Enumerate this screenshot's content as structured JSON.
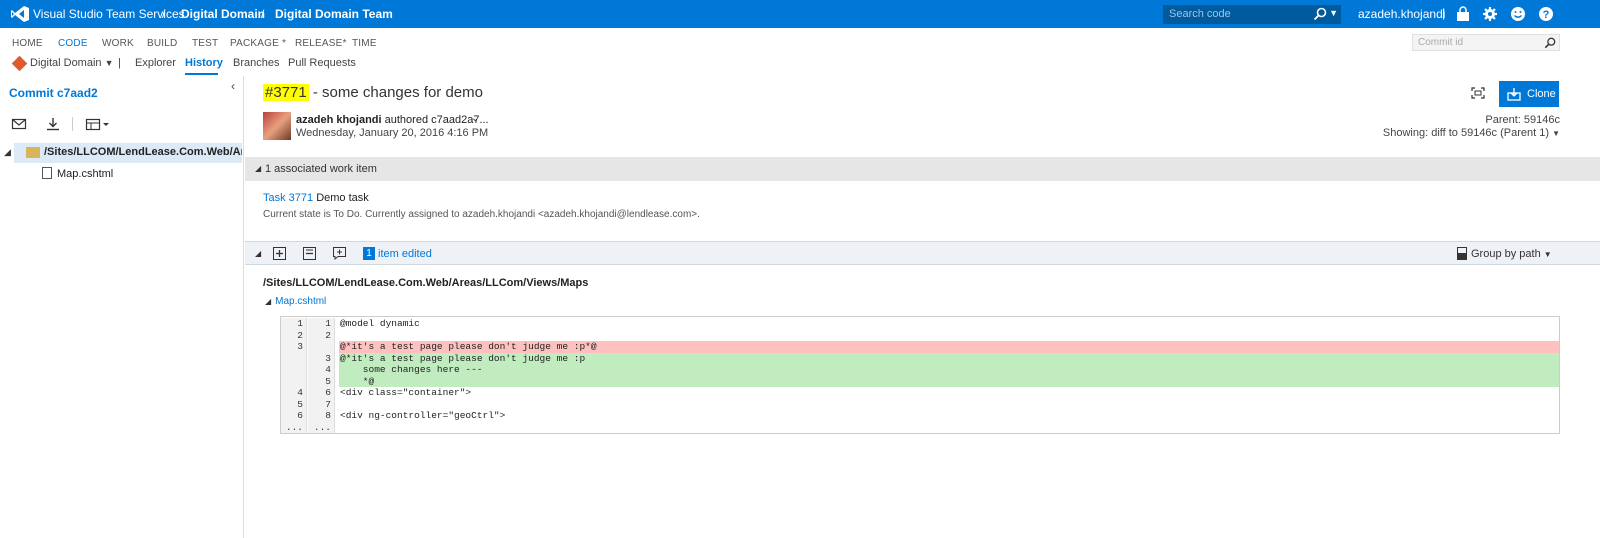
{
  "topbar": {
    "product": "Visual Studio Team Services",
    "sep1": "/",
    "project": "Digital Domain",
    "sep2": "/",
    "team": "Digital Domain Team",
    "search_placeholder": "Search code",
    "user": "azadeh.khojandi",
    "user_sep": "|"
  },
  "hubs": [
    "HOME",
    "CODE",
    "WORK",
    "BUILD",
    "TEST",
    "PACKAGE *",
    "RELEASE*",
    "TIME"
  ],
  "commit_search_placeholder": "Commit id",
  "subnav": {
    "repo": "Digital Domain",
    "sep": "|",
    "items": [
      "Explorer",
      "History",
      "Branches",
      "Pull Requests"
    ]
  },
  "left": {
    "title": "Commit c7aad2",
    "folder_path": "/Sites/LLCOM/LendLease.Com.Web/Areas/",
    "file": "Map.cshtml"
  },
  "commit": {
    "id_highlight": "#3771",
    "title_rest": " - some changes for demo",
    "author": "azadeh khojandi",
    "authored": " authored c7aad2a7...",
    "date": "Wednesday, January 20, 2016 4:16 PM",
    "parent": "Parent: 59146c",
    "showing": "Showing: diff to 59146c (Parent 1)",
    "clone_label": "Clone"
  },
  "workitems": {
    "header": "1 associated work item",
    "link": "Task 3771",
    "name": " Demo task",
    "state": "Current state is To Do. Currently assigned to azadeh.khojandi <azadeh.khojandi@lendlease.com>."
  },
  "changes": {
    "count": "1",
    "label": "item edited",
    "group_by": "Group by path",
    "file_path": "/Sites/LLCOM/LendLease.Com.Web/Areas/LLCom/Views/Maps",
    "file_name": "Map.cshtml"
  },
  "diff": [
    {
      "l": "1",
      "r": "1",
      "t": "",
      "code": "@model dynamic"
    },
    {
      "l": "2",
      "r": "2",
      "t": "",
      "code": ""
    },
    {
      "l": "3",
      "r": "",
      "t": "del",
      "code": "@*it's a test page please don't judge me :p*@"
    },
    {
      "l": "",
      "r": "3",
      "t": "add",
      "code": "@*it's a test page please don't judge me :p"
    },
    {
      "l": "",
      "r": "4",
      "t": "add",
      "code": "    some changes here ---"
    },
    {
      "l": "",
      "r": "5",
      "t": "add",
      "code": "    *@"
    },
    {
      "l": "4",
      "r": "6",
      "t": "",
      "code": "<div class=\"container\">"
    },
    {
      "l": "5",
      "r": "7",
      "t": "",
      "code": ""
    },
    {
      "l": "6",
      "r": "8",
      "t": "",
      "code": "<div ng-controller=\"geoCtrl\">"
    },
    {
      "l": "...",
      "r": "...",
      "t": "",
      "code": ""
    }
  ]
}
